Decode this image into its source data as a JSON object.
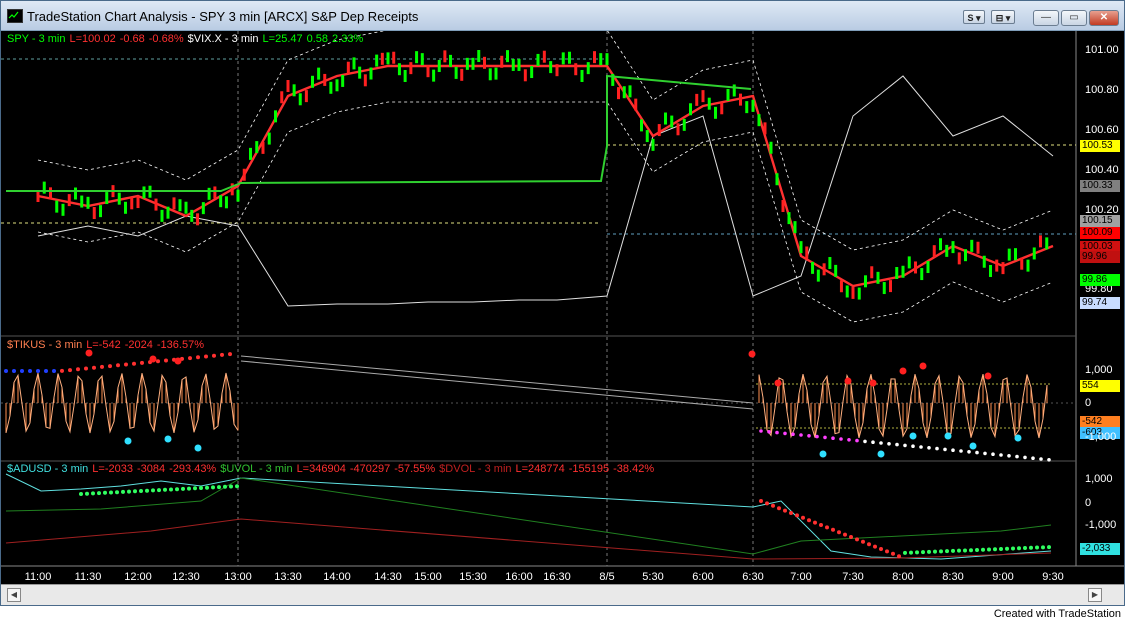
{
  "window": {
    "title": "TradeStation Chart Analysis - SPY  3 min  [ARCX] S&P Dep Receipts",
    "btn_s": "S ▾",
    "btn_grid": "⊟ ▾",
    "minimize": "—",
    "restore": "▭",
    "close": "✕"
  },
  "legends": {
    "price": [
      {
        "text": "SPY - 3 min",
        "color": "#00ff00"
      },
      {
        "text": "L=100.02",
        "color": "#ff3030"
      },
      {
        "text": "-0.68",
        "color": "#ff3030"
      },
      {
        "text": "-0.68%",
        "color": "#ff3030"
      },
      {
        "text": "$VIX.X - 3 min",
        "color": "#ffffff"
      },
      {
        "text": "L=25.47",
        "color": "#00ff00"
      },
      {
        "text": "0.58",
        "color": "#00ff00"
      },
      {
        "text": "2.33%",
        "color": "#00ff00"
      }
    ],
    "tick": [
      {
        "text": "$TIKUS - 3 min",
        "color": "#ff7f50"
      },
      {
        "text": "L=-542",
        "color": "#ff3030"
      },
      {
        "text": "-2024",
        "color": "#ff3030"
      },
      {
        "text": "-136.57%",
        "color": "#ff3030"
      }
    ],
    "breadth": [
      {
        "text": "$ADUSD - 3 min",
        "color": "#40e0e0"
      },
      {
        "text": "L=-2033",
        "color": "#ff3030"
      },
      {
        "text": "-3084",
        "color": "#ff3030"
      },
      {
        "text": "-293.43%",
        "color": "#ff3030"
      },
      {
        "text": "$UVOL - 3 min",
        "color": "#30c030"
      },
      {
        "text": "L=346904",
        "color": "#ff3030"
      },
      {
        "text": "-470297",
        "color": "#ff3030"
      },
      {
        "text": "-57.55%",
        "color": "#ff3030"
      },
      {
        "text": "$DVOL - 3 min",
        "color": "#c02020"
      },
      {
        "text": "L=248774",
        "color": "#ff3030"
      },
      {
        "text": "-155195",
        "color": "#ff3030"
      },
      {
        "text": "-38.42%",
        "color": "#ff3030"
      }
    ]
  },
  "price_axis": [
    "101.00",
    "100.80",
    "100.60",
    "100.40",
    "100.20",
    "100.00",
    "99.80"
  ],
  "price_tags": [
    {
      "text": "100.53",
      "bg": "#ffff00",
      "fg": "#000000"
    },
    {
      "text": "100.33",
      "bg": "#808080",
      "fg": "#000000"
    },
    {
      "text": "100.15",
      "bg": "#a0a0a0",
      "fg": "#000000"
    },
    {
      "text": "100.09",
      "bg": "#ff0000",
      "fg": "#000000"
    },
    {
      "text": "100.03",
      "bg": "#d01010",
      "fg": "#000000"
    },
    {
      "text": "99.96",
      "bg": "#c01010",
      "fg": "#000000"
    },
    {
      "text": "99.86",
      "bg": "#00ff00",
      "fg": "#000000"
    },
    {
      "text": "99.74",
      "bg": "#c8dcff",
      "fg": "#000000"
    }
  ],
  "tick_axis": [
    "1,000",
    "0",
    "-1,000"
  ],
  "tick_tags": [
    {
      "text": "554",
      "bg": "#ffff00",
      "fg": "#000000"
    },
    {
      "text": "-542",
      "bg": "#ff7f20",
      "fg": "#000000"
    },
    {
      "text": "-603",
      "bg": "#40c0ff",
      "fg": "#000000"
    }
  ],
  "breadth_axis": [
    "1,000",
    "0",
    "-1,000"
  ],
  "breadth_tags": [
    {
      "text": "-2,033",
      "bg": "#30e0e0",
      "fg": "#000000"
    }
  ],
  "time_axis": [
    "11:00",
    "11:30",
    "12:00",
    "12:30",
    "13:00",
    "13:30",
    "14:00",
    "14:30",
    "15:00",
    "15:30",
    "16:00",
    "16:30",
    "8/5",
    "5:30",
    "6:00",
    "6:30",
    "7:00",
    "7:30",
    "8:00",
    "8:30",
    "9:00",
    "9:30"
  ],
  "footer": "Created with TradeStation",
  "chart_data": {
    "type": "line",
    "instrument": "SPY - 3 min",
    "price_range": [
      99.7,
      101.05
    ],
    "x": [
      "11:00",
      "11:30",
      "12:00",
      "12:30",
      "13:00",
      "13:30",
      "14:00",
      "14:30",
      "15:00",
      "15:30",
      "16:00",
      "16:30",
      "8/5",
      "5:30",
      "6:00",
      "6:30",
      "7:00",
      "7:30",
      "8:00",
      "8:30",
      "9:00",
      "9:30"
    ],
    "series": [
      {
        "name": "SPY - 3 min",
        "values": [
          100.3,
          100.25,
          100.3,
          100.2,
          100.35,
          100.8,
          100.9,
          100.95,
          100.95,
          100.95,
          100.95,
          100.95,
          100.95,
          100.6,
          100.75,
          100.8,
          100.0,
          99.85,
          99.9,
          100.05,
          99.95,
          100.05
        ]
      },
      {
        "name": "$VIX.X - 3 min",
        "values": [
          100.1,
          100.15,
          100.1,
          100.2,
          100.15,
          99.75,
          99.76,
          99.76,
          99.77,
          99.77,
          99.78,
          99.78,
          99.8,
          100.6,
          100.7,
          99.8,
          99.9,
          100.7,
          100.9,
          100.6,
          100.7,
          100.5
        ]
      }
    ]
  }
}
